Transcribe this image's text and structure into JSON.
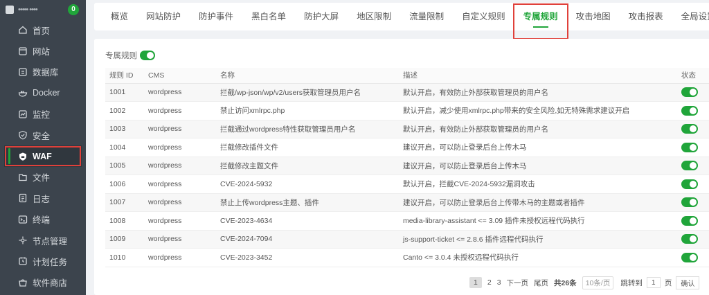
{
  "sidebar": {
    "user": "••••• ••••",
    "badge": "0",
    "items": [
      {
        "label": "首页",
        "icon": "home-icon"
      },
      {
        "label": "网站",
        "icon": "globe-icon"
      },
      {
        "label": "数据库",
        "icon": "database-icon"
      },
      {
        "label": "Docker",
        "icon": "docker-icon"
      },
      {
        "label": "监控",
        "icon": "chart-icon"
      },
      {
        "label": "安全",
        "icon": "shield-check-icon"
      },
      {
        "label": "WAF",
        "icon": "waf-shield-icon"
      },
      {
        "label": "文件",
        "icon": "folder-icon"
      },
      {
        "label": "日志",
        "icon": "log-icon"
      },
      {
        "label": "终端",
        "icon": "terminal-icon"
      },
      {
        "label": "节点管理",
        "icon": "node-icon"
      },
      {
        "label": "计划任务",
        "icon": "clock-icon"
      },
      {
        "label": "软件商店",
        "icon": "store-icon"
      }
    ],
    "active_index": 6
  },
  "tabs": [
    "概览",
    "网站防护",
    "防护事件",
    "黑白名单",
    "防护大屏",
    "地区限制",
    "流量限制",
    "自定义规则",
    "专属规则",
    "攻击地图",
    "攻击报表",
    "全局设置"
  ],
  "active_tab_index": 8,
  "panel": {
    "toggle_label": "专属规则",
    "toggle_on": true,
    "columns": [
      "规则 ID",
      "CMS",
      "名称",
      "描述",
      "状态"
    ],
    "rows": [
      {
        "id": "1001",
        "cms": "wordpress",
        "name": "拦截/wp-json/wp/v2/users获取管理员用户名",
        "desc": "默认开启，有效防止外部获取管理员的用户名",
        "enabled": true
      },
      {
        "id": "1002",
        "cms": "wordpress",
        "name": "禁止访问xmlrpc.php",
        "desc": "默认开启，减少使用xmlrpc.php带来的安全风险,如无特殊需求建议开启",
        "enabled": true
      },
      {
        "id": "1003",
        "cms": "wordpress",
        "name": "拦截通过wordpress特性获取管理员用户名",
        "desc": "默认开启，有效防止外部获取管理员的用户名",
        "enabled": true
      },
      {
        "id": "1004",
        "cms": "wordpress",
        "name": "拦截修改插件文件",
        "desc": "建议开启，可以防止登录后台上传木马",
        "enabled": true
      },
      {
        "id": "1005",
        "cms": "wordpress",
        "name": "拦截修改主题文件",
        "desc": "建议开启，可以防止登录后台上传木马",
        "enabled": true
      },
      {
        "id": "1006",
        "cms": "wordpress",
        "name": "CVE-2024-5932",
        "desc": "默认开启，拦截CVE-2024-5932漏洞攻击",
        "enabled": true
      },
      {
        "id": "1007",
        "cms": "wordpress",
        "name": "禁止上传wordpress主题、插件",
        "desc": "建议开启，可以防止登录后台上传带木马的主题或者插件",
        "enabled": true
      },
      {
        "id": "1008",
        "cms": "wordpress",
        "name": "CVE-2023-4634",
        "desc": "media-library-assistant <= 3.09 插件未授权远程代码执行",
        "enabled": true
      },
      {
        "id": "1009",
        "cms": "wordpress",
        "name": "CVE-2024-7094",
        "desc": "js-support-ticket <= 2.8.6 插件远程代码执行",
        "enabled": true
      },
      {
        "id": "1010",
        "cms": "wordpress",
        "name": "CVE-2023-3452",
        "desc": "Canto <= 3.0.4 未授权远程代码执行",
        "enabled": true
      }
    ]
  },
  "pager": {
    "pages": [
      "1",
      "2",
      "3"
    ],
    "current": "1",
    "next": "下一页",
    "last": "尾页",
    "total": "共26条",
    "per_page": "10条/页",
    "goto_label": "跳转到",
    "goto_value": "1",
    "page_unit": "页",
    "confirm": "确认"
  },
  "colors": {
    "accent": "#20a53a",
    "highlight": "#e0403a",
    "sidebar": "#3c444d"
  }
}
